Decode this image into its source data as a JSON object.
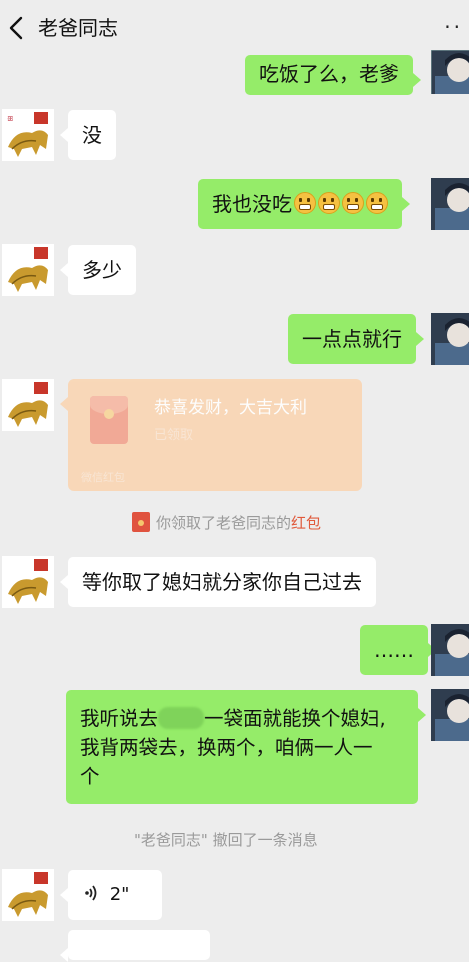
{
  "header": {
    "title": "老爸同志",
    "more": "··"
  },
  "messages": {
    "m1": "吃饭了么，老爹",
    "m2": "没",
    "m3": "我也没吃",
    "m4": "多少",
    "m5": "一点点就行",
    "m7": "等你取了媳妇就分家你自己过去",
    "m8": "……",
    "m9a": "我听说去",
    "m9b": "一袋面就能换个媳妇,",
    "m9c": "我背两袋去，换两个，咱俩一人一",
    "m9d": "个",
    "m10": "2\""
  },
  "red_packet": {
    "title": "恭喜发财，大吉大利",
    "status": "已领取",
    "footer": "微信红包"
  },
  "system": {
    "received_prefix": "你领取了老爸同志的",
    "received_link": "红包",
    "recall": "\"老爸同志\" 撤回了一条消息"
  },
  "icons": {
    "back": "chevron-left-icon",
    "more": "more-dots-icon",
    "emoji": "grin-emoji-icon",
    "voice": "voice-wave-icon",
    "red_packet": "red-packet-icon"
  },
  "colors": {
    "background": "#ededed",
    "outgoing_bubble": "#95ec69",
    "incoming_bubble": "#ffffff",
    "red_packet": "#f9d6b4",
    "link_red": "#e05a3c"
  }
}
